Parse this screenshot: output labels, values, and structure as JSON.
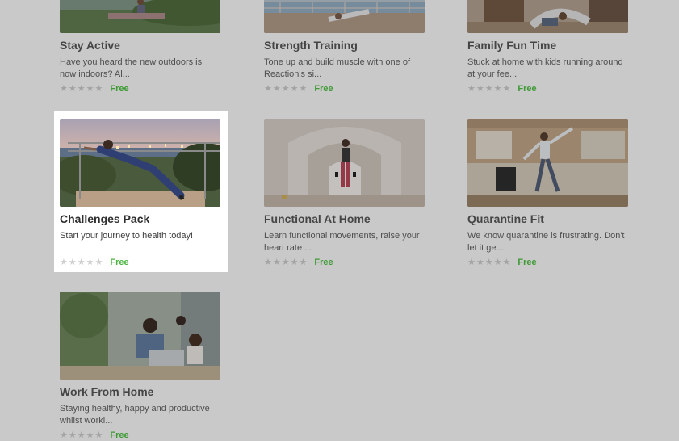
{
  "cards": [
    {
      "title": "Stay Active",
      "description": "Have you heard the new outdoors is now indoors? Al...",
      "rating": 0,
      "max_rating": 5,
      "price": "Free",
      "image_icon": "outdoor-workout-photo"
    },
    {
      "title": "Strength Training",
      "description": "Tone up and build muscle with one of Reaction's si...",
      "rating": 0,
      "max_rating": 5,
      "price": "Free",
      "image_icon": "plank-workout-photo"
    },
    {
      "title": "Family Fun Time",
      "description": "Stuck at home with kids running around at your fee...",
      "rating": 0,
      "max_rating": 5,
      "price": "Free",
      "image_icon": "family-play-photo"
    },
    {
      "title": "Challenges Pack",
      "description": "Start your journey to health today!",
      "rating": 0,
      "max_rating": 5,
      "price": "Free",
      "image_icon": "rail-stretch-photo"
    },
    {
      "title": "Functional At Home",
      "description": "Learn functional movements, raise your heart rate ...",
      "rating": 0,
      "max_rating": 5,
      "price": "Free",
      "image_icon": "dumbbell-woman-photo"
    },
    {
      "title": "Quarantine Fit",
      "description": "We know quarantine is frustrating. Don't let it ge...",
      "rating": 0,
      "max_rating": 5,
      "price": "Free",
      "image_icon": "kitchen-dance-photo"
    },
    {
      "title": "Work From Home",
      "description": "Staying healthy, happy and productive whilst worki...",
      "rating": 0,
      "max_rating": 5,
      "price": "Free",
      "image_icon": "work-from-home-photo"
    }
  ],
  "colors": {
    "price": "#3e9a35",
    "overlay": "#c9c9c9",
    "highlight_bg": "#ffffff"
  }
}
